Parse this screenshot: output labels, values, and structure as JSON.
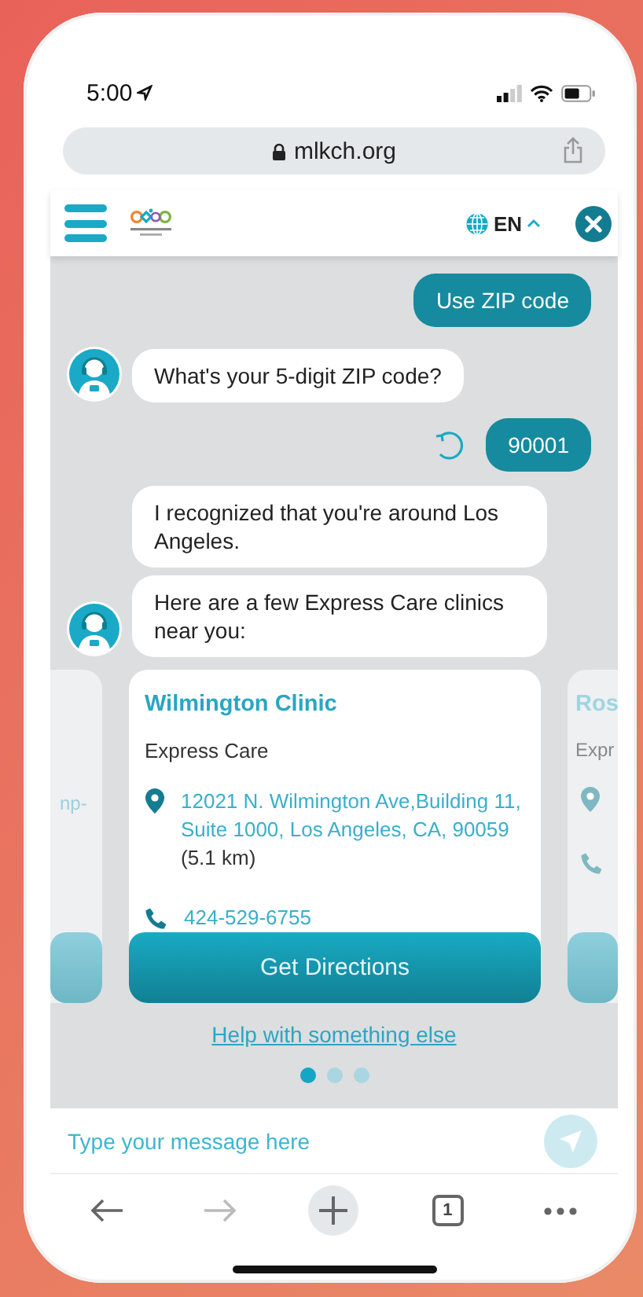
{
  "status_bar": {
    "time": "5:00"
  },
  "browser": {
    "url": "mlkch.org"
  },
  "header": {
    "language": "EN"
  },
  "messages": [
    {
      "kind": "user",
      "text": "Use ZIP code",
      "retry": false
    },
    {
      "kind": "bot",
      "text": "What's your 5-digit ZIP code?",
      "avatar": true
    },
    {
      "kind": "user",
      "text": "90001",
      "retry": true
    },
    {
      "kind": "bot",
      "text": "I recognized that you're around Los Angeles.",
      "avatar": false
    },
    {
      "kind": "bot",
      "text": "Here are a few Express Care clinics near you:",
      "avatar": true
    }
  ],
  "carousel": {
    "previous_card": {
      "address": "np-"
    },
    "card": {
      "name": "Wilmington Clinic",
      "type": "Express Care",
      "address": "12021 N. Wilmington Ave,Building 11, Suite 1000, Los Angeles, CA, 90059",
      "distance": "(5.1 km)",
      "phone": "424-529-6755",
      "button": "Get Directions"
    },
    "next_card": {
      "name": "Ros",
      "type": "Expr"
    },
    "dots": [
      {
        "selected": true
      },
      {
        "selected": false
      },
      {
        "selected": false
      }
    ]
  },
  "help_link": "Help with something else",
  "composer": {
    "placeholder": "Type your message here"
  },
  "toolbar": {
    "tab_count": "1"
  }
}
